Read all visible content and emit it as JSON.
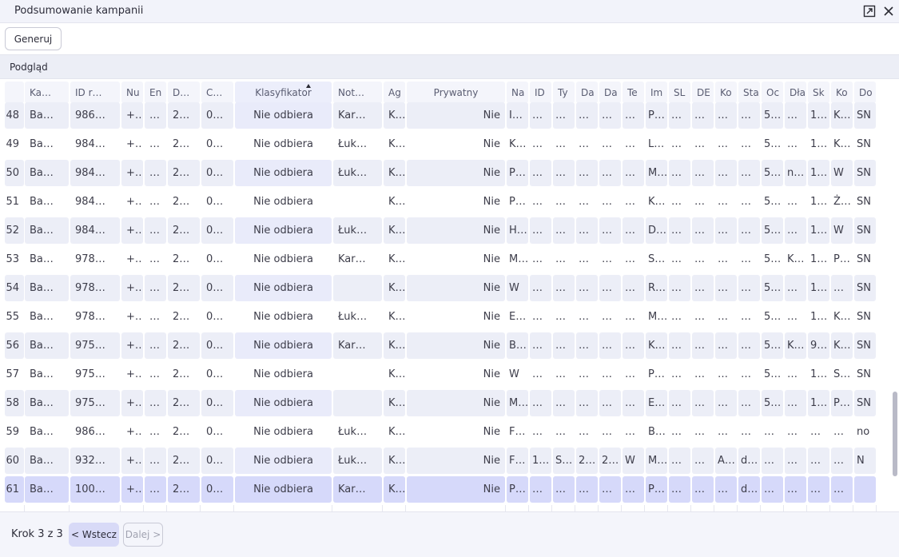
{
  "window": {
    "title": "Podsumowanie kampanii",
    "popout_icon": "popout-icon",
    "close_icon": "close-icon"
  },
  "toolbar": {
    "generate_label": "Generuj"
  },
  "section": {
    "title": "Podgląd"
  },
  "table": {
    "sorted_column": "Klasyfikator",
    "sort_direction": "ascending",
    "columns": [
      "",
      "Ka…",
      "ID r…",
      "Nu",
      "En",
      "D…",
      "C…",
      "Klasyfikator",
      "Not…",
      "Ag",
      "Prywatny",
      "Na",
      "ID",
      "Ty",
      "Da",
      "Da",
      "Te",
      "Im",
      "SL",
      "DE",
      "Ko",
      "Sta",
      "Oc",
      "Dła",
      "Sk",
      "Ko",
      "Do"
    ],
    "selected_row_index": 13,
    "rows": [
      [
        "48",
        "Ba…",
        "986…",
        "+…",
        "…",
        "2…",
        "0…",
        "Nie odbiera",
        "Kar…",
        "K…",
        "Nie",
        "I…",
        "…",
        "…",
        "…",
        "…",
        "…",
        "P…",
        "…",
        "…",
        "…",
        "…",
        "5…",
        "…",
        "1…",
        "K…",
        "SN"
      ],
      [
        "49",
        "Ba…",
        "984…",
        "+…",
        "…",
        "2…",
        "0…",
        "Nie odbiera",
        "Łuk…",
        "K…",
        "Nie",
        "K…",
        "…",
        "…",
        "…",
        "…",
        "…",
        "L…",
        "…",
        "…",
        "…",
        "…",
        "5…",
        "…",
        "1…",
        "K…",
        "SN"
      ],
      [
        "50",
        "Ba…",
        "984…",
        "+…",
        "…",
        "2…",
        "0…",
        "Nie odbiera",
        "Łuk…",
        "K…",
        "Nie",
        "P…",
        "…",
        "…",
        "…",
        "…",
        "…",
        "M…",
        "…",
        "…",
        "…",
        "…",
        "5…",
        "n…",
        "1…",
        "W",
        "SN"
      ],
      [
        "51",
        "Ba…",
        "984…",
        "+…",
        "…",
        "2…",
        "0…",
        "Nie odbiera",
        "",
        "K…",
        "Nie",
        "P…",
        "…",
        "…",
        "…",
        "…",
        "…",
        "K…",
        "…",
        "…",
        "…",
        "…",
        "5…",
        "…",
        "1…",
        "Ż…",
        "SN"
      ],
      [
        "52",
        "Ba…",
        "984…",
        "+…",
        "…",
        "2…",
        "0…",
        "Nie odbiera",
        "Łuk…",
        "K…",
        "Nie",
        "H…",
        "…",
        "…",
        "…",
        "…",
        "…",
        "D…",
        "…",
        "…",
        "…",
        "…",
        "5…",
        "…",
        "1…",
        "W",
        "SN"
      ],
      [
        "53",
        "Ba…",
        "978…",
        "+…",
        "…",
        "2…",
        "0…",
        "Nie odbiera",
        "Kar…",
        "K…",
        "Nie",
        "M…",
        "…",
        "…",
        "…",
        "…",
        "…",
        "S…",
        "…",
        "…",
        "…",
        "…",
        "5…",
        "K…",
        "1…",
        "P…",
        "SN"
      ],
      [
        "54",
        "Ba…",
        "978…",
        "+…",
        "…",
        "2…",
        "0…",
        "Nie odbiera",
        "",
        "K…",
        "Nie",
        "W",
        "…",
        "…",
        "…",
        "…",
        "…",
        "R…",
        "…",
        "…",
        "…",
        "…",
        "5…",
        "…",
        "1…",
        "…",
        "SN"
      ],
      [
        "55",
        "Ba…",
        "978…",
        "+…",
        "…",
        "2…",
        "0…",
        "Nie odbiera",
        "Łuk…",
        "K…",
        "Nie",
        "E…",
        "…",
        "…",
        "…",
        "…",
        "…",
        "M…",
        "…",
        "…",
        "…",
        "…",
        "5…",
        "…",
        "1…",
        "K…",
        "SN"
      ],
      [
        "56",
        "Ba…",
        "975…",
        "+…",
        "…",
        "2…",
        "0…",
        "Nie odbiera",
        "Kar…",
        "K…",
        "Nie",
        "B…",
        "…",
        "…",
        "…",
        "…",
        "…",
        "K…",
        "…",
        "…",
        "…",
        "…",
        "5…",
        "K…",
        "9…",
        "K…",
        "SN"
      ],
      [
        "57",
        "Ba…",
        "975…",
        "+…",
        "…",
        "2…",
        "0…",
        "Nie odbiera",
        "",
        "K…",
        "Nie",
        "W",
        "…",
        "…",
        "…",
        "…",
        "…",
        "P…",
        "…",
        "…",
        "…",
        "…",
        "5…",
        "…",
        "1…",
        "S…",
        "SN"
      ],
      [
        "58",
        "Ba…",
        "975…",
        "+…",
        "…",
        "2…",
        "0…",
        "Nie odbiera",
        "",
        "K…",
        "Nie",
        "M…",
        "…",
        "…",
        "…",
        "…",
        "…",
        "E…",
        "…",
        "…",
        "…",
        "…",
        "5…",
        "…",
        "1…",
        "P…",
        "SN"
      ],
      [
        "59",
        "Ba…",
        "986…",
        "+…",
        "…",
        "2…",
        "0…",
        "Nie odbiera",
        "Łuk…",
        "K…",
        "Nie",
        "F…",
        "…",
        "…",
        "…",
        "…",
        "…",
        "B…",
        "…",
        "…",
        "…",
        "…",
        "…",
        "…",
        "…",
        "…",
        "no"
      ],
      [
        "60",
        "Ba…",
        "932…",
        "+…",
        "…",
        "2…",
        "0…",
        "Nie odbiera",
        "Łuk…",
        "K…",
        "Nie",
        "F…",
        "1…",
        "S…",
        "2…",
        "2…",
        "W",
        "M…",
        "…",
        "…",
        "A…",
        "d…",
        "…",
        "…",
        "…",
        "…",
        "N"
      ],
      [
        "61",
        "Ba…",
        "100…",
        "+…",
        "…",
        "2…",
        "0…",
        "Nie odbiera",
        "Kar…",
        "K…",
        "Nie",
        "P…",
        "…",
        "…",
        "…",
        "…",
        "…",
        "P…",
        "…",
        "…",
        "…",
        "d…",
        "…",
        "…",
        "…",
        "…",
        ""
      ]
    ]
  },
  "footer": {
    "step_label": "Krok 3 z 3",
    "back_label": "< Wstecz",
    "next_label": "Dalej >"
  }
}
